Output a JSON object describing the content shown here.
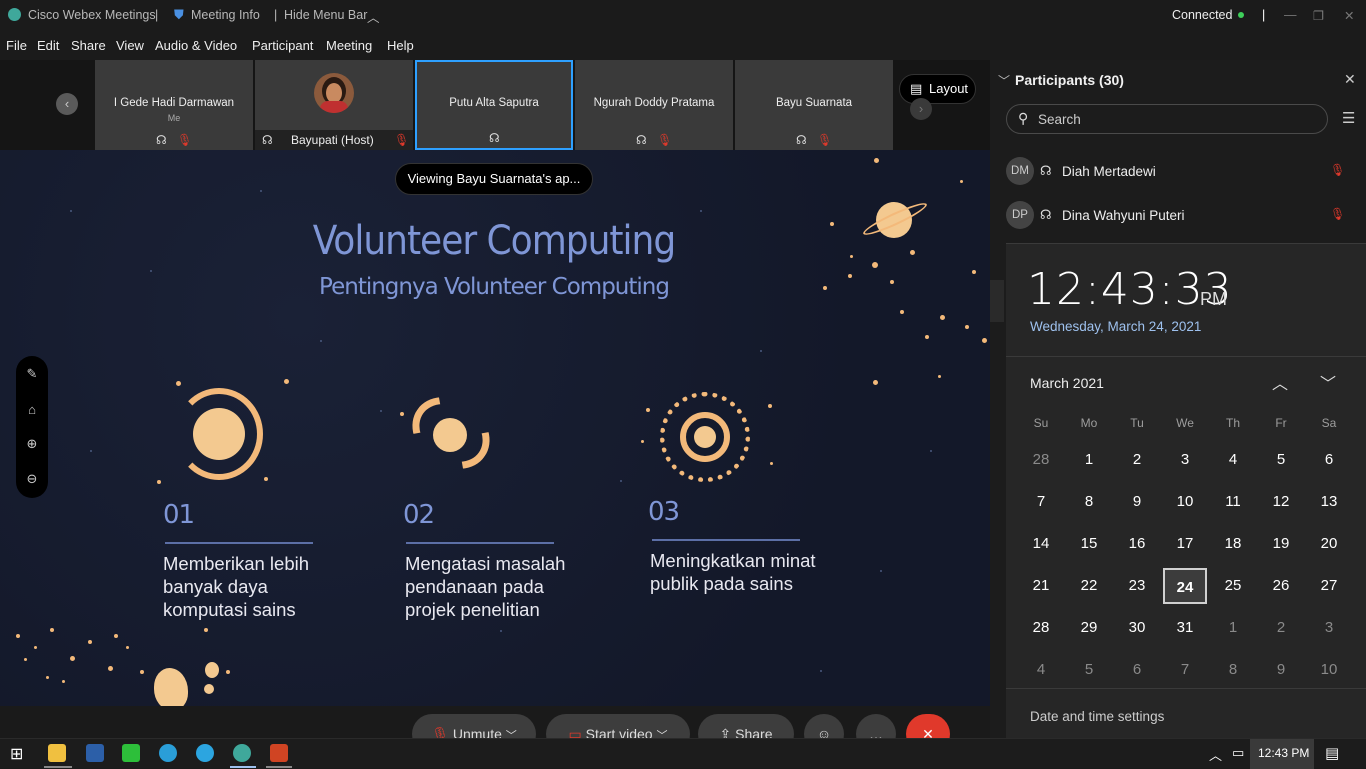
{
  "titlebar": {
    "app_name": "Cisco Webex Meetings",
    "meeting_info": "Meeting Info",
    "hide_menu": "Hide Menu Bar",
    "status": "Connected"
  },
  "menu": [
    "File",
    "Edit",
    "Share",
    "View",
    "Audio & Video",
    "Participant",
    "Meeting",
    "Help"
  ],
  "videos": [
    {
      "name": "I Gede Hadi Darmawan",
      "sub": "Me"
    },
    {
      "name": "Bayupati  (Host)",
      "sub": ""
    },
    {
      "name": "Putu Alta Saputra",
      "sub": ""
    },
    {
      "name": "Ngurah Doddy Pratama",
      "sub": ""
    },
    {
      "name": "Bayu Suarnata",
      "sub": ""
    }
  ],
  "layout_label": "Layout",
  "viewing_label": "Viewing Bayu Suarnata's ap...",
  "slide": {
    "title": "Volunteer Computing",
    "subtitle": "Pentingnya Volunteer Computing",
    "points": [
      {
        "num": "01",
        "text": "Memberikan lebih banyak daya komputasi sains"
      },
      {
        "num": "02",
        "text": "Mengatasi masalah pendanaan pada projek penelitian"
      },
      {
        "num": "03",
        "text": "Meningkatkan minat publik pada sains"
      }
    ]
  },
  "participants": {
    "header": "Participants (30)",
    "search_placeholder": "Search",
    "list": [
      {
        "initials": "DM",
        "name": "Diah Mertadewi"
      },
      {
        "initials": "DP",
        "name": "Dina Wahyuni Puteri"
      }
    ]
  },
  "clock": {
    "time": "12:43:33",
    "ampm": "PM",
    "date": "Wednesday, March 24, 2021",
    "month": "March 2021",
    "weekdays": [
      "Su",
      "Mo",
      "Tu",
      "We",
      "Th",
      "Fr",
      "Sa"
    ],
    "weeks": [
      [
        "28",
        "1",
        "2",
        "3",
        "4",
        "5",
        "6"
      ],
      [
        "7",
        "8",
        "9",
        "10",
        "11",
        "12",
        "13"
      ],
      [
        "14",
        "15",
        "16",
        "17",
        "18",
        "19",
        "20"
      ],
      [
        "21",
        "22",
        "23",
        "24",
        "25",
        "26",
        "27"
      ],
      [
        "28",
        "29",
        "30",
        "31",
        "1",
        "2",
        "3"
      ],
      [
        "4",
        "5",
        "6",
        "7",
        "8",
        "9",
        "10"
      ]
    ],
    "today": "24",
    "settings_link": "Date and time settings"
  },
  "controls": {
    "unmute": "Unmute",
    "start_video": "Start video",
    "share": "Share"
  },
  "taskbar": {
    "time": "12:43 PM"
  },
  "colors": {
    "accent_blue": "#2ea0ff",
    "slide_title": "#7f96d6",
    "orange": "#f3b97a",
    "end_red": "#e0392b"
  }
}
